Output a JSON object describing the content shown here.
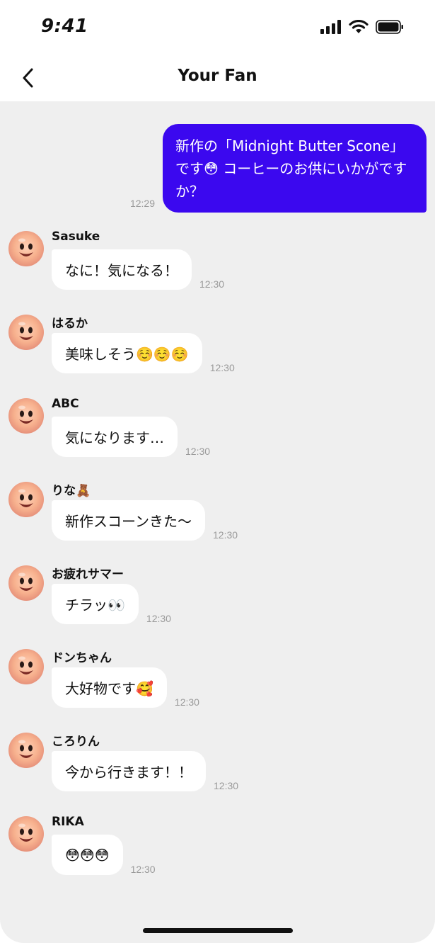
{
  "status_bar": {
    "time": "9:41"
  },
  "header": {
    "title": "Your Fan"
  },
  "outgoing_message": {
    "text": "新作の「Midnight Butter Scone」です😳 コーヒーのお供にいかがですか？",
    "time": "12:29",
    "bubble_color": "#3b08ef"
  },
  "messages": [
    {
      "sender": "Sasuke",
      "text": "なに！気になる！",
      "time": "12:30"
    },
    {
      "sender": "はるか",
      "text": "美味しそう☺️☺️☺️",
      "time": "12:30"
    },
    {
      "sender": "ABC",
      "text": "気になります…",
      "time": "12:30"
    },
    {
      "sender": "りな🧸",
      "text": "新作スコーンきた〜",
      "time": "12:30"
    },
    {
      "sender": "お疲れサマー",
      "text": "チラッ👀",
      "time": "12:30"
    },
    {
      "sender": "ドンちゃん",
      "text": "大好物です🥰",
      "time": "12:30"
    },
    {
      "sender": "ころりん",
      "text": "今から行きます！！",
      "time": "12:30"
    },
    {
      "sender": "RIKA",
      "text": "😳😳😳",
      "time": "12:30"
    }
  ],
  "colors": {
    "chat_background": "#efefef",
    "incoming_bubble": "#ffffff",
    "timestamp": "#9a9a9a"
  },
  "icons": [
    "signal-icon",
    "wifi-icon",
    "battery-icon",
    "back-arrow-icon",
    "avatar-emoji-icon"
  ]
}
